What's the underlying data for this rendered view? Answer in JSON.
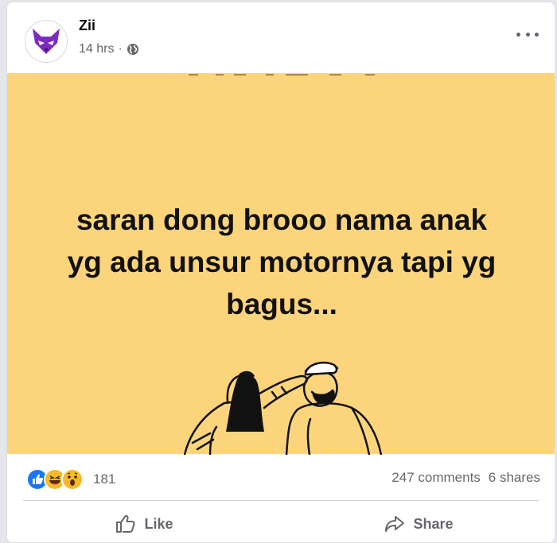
{
  "post": {
    "author": "Zii",
    "time": "14 hrs",
    "separator": "·",
    "privacy_icon": "globe-icon",
    "text": "saran dong brooo nama anak\nyg ada unsur motornya tapi yg\nbagus...",
    "image_bg_color": "#fcd47c"
  },
  "stats": {
    "reaction_icons": [
      "like-icon",
      "haha-icon",
      "wow-icon"
    ],
    "reaction_count": "181",
    "comments": "247 comments",
    "shares": "6 shares"
  },
  "actions": {
    "like_label": "Like",
    "share_label": "Share"
  },
  "colors": {
    "like_blue": "#1877f2",
    "emoji_yellow": "#f7b928",
    "muted_text": "#65676b"
  }
}
